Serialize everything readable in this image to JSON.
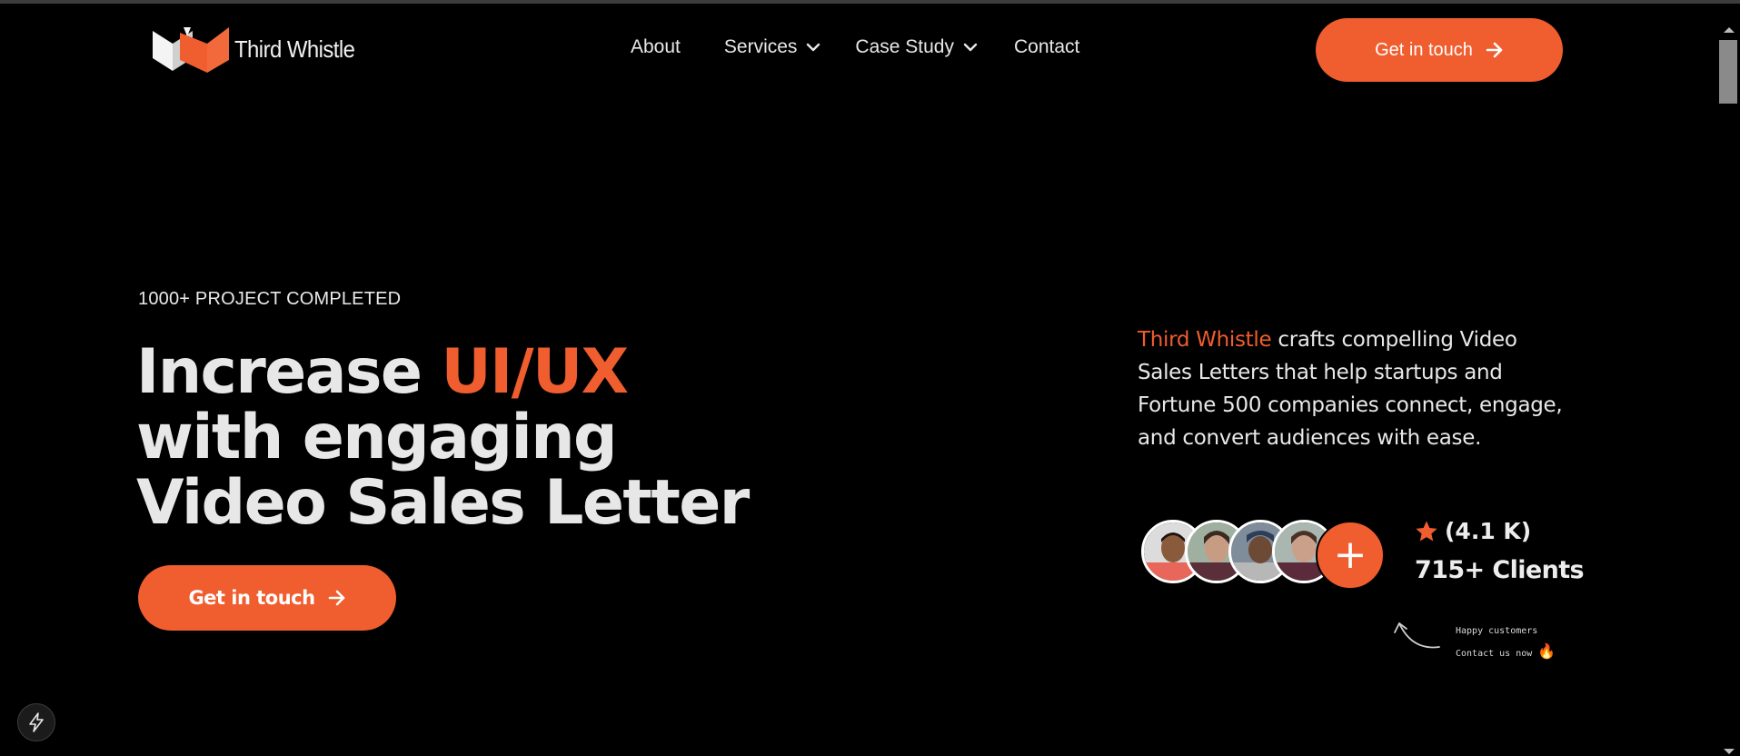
{
  "header": {
    "logo_text": "Third Whistle",
    "nav": [
      {
        "label": "About",
        "has_dropdown": false
      },
      {
        "label": "Services",
        "has_dropdown": true
      },
      {
        "label": "Case Study",
        "has_dropdown": true
      },
      {
        "label": "Contact",
        "has_dropdown": false
      }
    ],
    "cta_label": "Get in touch"
  },
  "hero": {
    "eyebrow": "1000+ PROJECT COMPLETED",
    "headline_part1": "Increase ",
    "headline_highlight": "UI/UX",
    "headline_line2": "with engaging",
    "headline_line3": "Video Sales Letter",
    "cta_label": "Get in touch",
    "description_brand": "Third Whistle",
    "description_rest": " crafts compelling Video Sales Letters that help startups and Fortune 500 companies connect, engage, and convert audiences with ease.",
    "rating": "(4.1 K)",
    "clients": "715+ Clients",
    "plus_symbol": "+",
    "hint_line1": "Happy customers",
    "hint_line2": "Contact us now",
    "hint_emoji": "🔥"
  },
  "colors": {
    "accent": "#f05d2e",
    "background": "#000000",
    "text": "#e8e8e8"
  },
  "icons": {
    "nav_dropdown": "chevron-down-icon",
    "cta": "arrow-right-icon",
    "rating": "star-icon",
    "floating": "bolt-icon"
  }
}
